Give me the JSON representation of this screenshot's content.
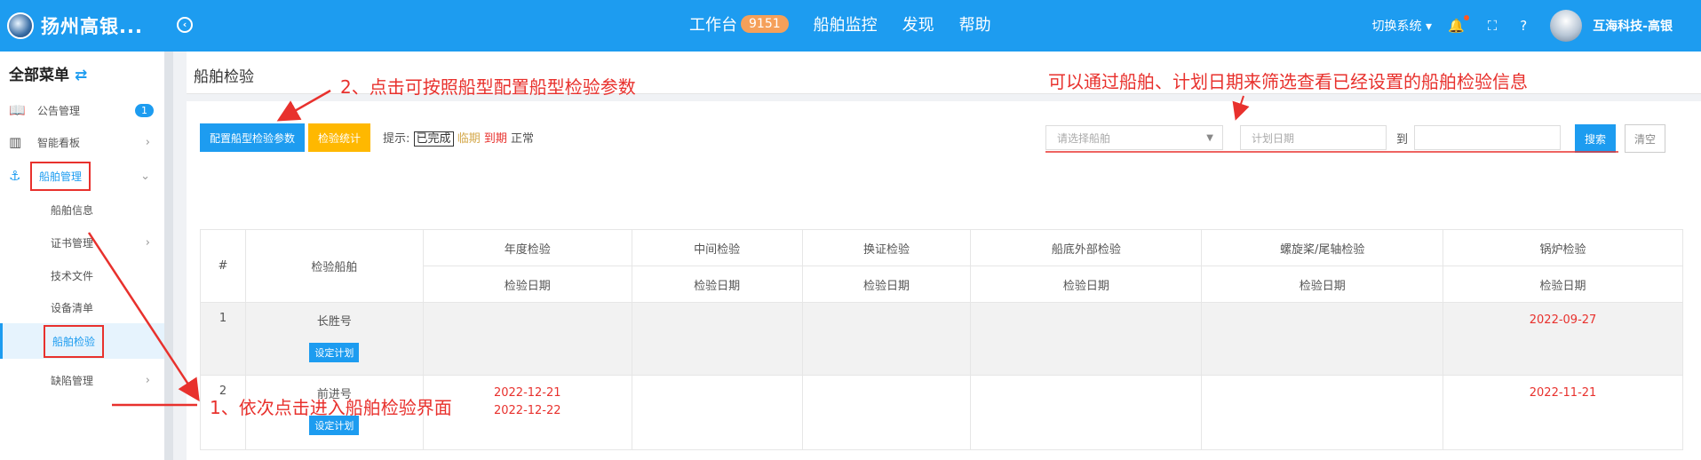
{
  "app": {
    "title": "扬州高银..."
  },
  "topnav": {
    "items": [
      {
        "label": "工作台",
        "badge": "9151"
      },
      {
        "label": "船舶监控"
      },
      {
        "label": "发现"
      },
      {
        "label": "帮助"
      }
    ],
    "switch_system": "切换系统",
    "user": "互海科技-高银"
  },
  "sidebar": {
    "title": "全部菜单",
    "items": [
      {
        "label": "公告管理",
        "count": "1"
      },
      {
        "label": "智能看板"
      },
      {
        "label": "船舶管理"
      },
      {
        "label": "船舶信息"
      },
      {
        "label": "证书管理"
      },
      {
        "label": "技术文件"
      },
      {
        "label": "设备清单"
      },
      {
        "label": "船舶检验"
      },
      {
        "label": "缺陷管理"
      }
    ]
  },
  "page": {
    "title": "船舶检验",
    "buttons": {
      "config": "配置船型检验参数",
      "stats": "检验统计",
      "search": "搜索",
      "clear": "清空"
    },
    "hint": {
      "prefix": "提示:",
      "done": "已完成",
      "near": "临期",
      "overdue": "到期",
      "normal": "正常"
    },
    "filters": {
      "ship_placeholder": "请选择船舶",
      "date_placeholder": "计划日期",
      "to": "到"
    }
  },
  "table": {
    "headers": [
      "#",
      "检验船舶",
      "年度检验",
      "中间检验",
      "换证检验",
      "船底外部检验",
      "螺旋桨/尾轴检验",
      "锅炉检验"
    ],
    "sub_header": "检验日期",
    "plan_button": "设定计划",
    "rows": [
      {
        "index": "1",
        "ship": "长胜号",
        "annual": [],
        "intermediate": [],
        "renewal": [],
        "bottom": [],
        "propeller": [],
        "boiler": [
          "2022-09-27"
        ]
      },
      {
        "index": "2",
        "ship": "前进号",
        "annual": [
          "2022-12-21",
          "2022-12-22"
        ],
        "intermediate": [],
        "renewal": [],
        "bottom": [],
        "propeller": [],
        "boiler": [
          "2022-11-21"
        ]
      }
    ]
  },
  "annotations": {
    "a1": "1、依次点击进入船舶检验界面",
    "a2": "2、点击可按照船型配置船型检验参数",
    "a3": "可以通过船舶、计划日期来筛选查看已经设置的船舶检验信息"
  },
  "colors": {
    "primary": "#1d9cf0",
    "warning": "#ffb800",
    "danger": "#e8312d"
  }
}
